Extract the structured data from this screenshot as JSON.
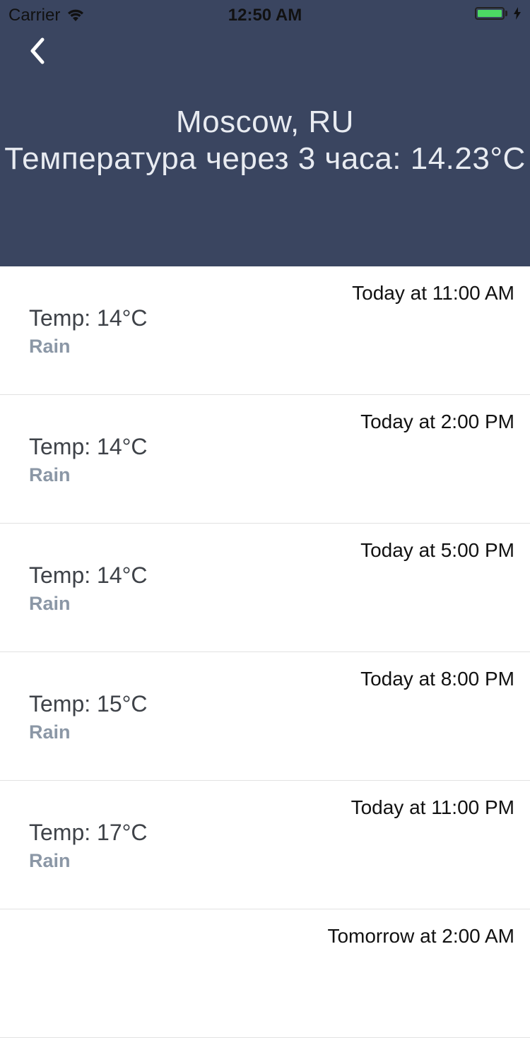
{
  "status_bar": {
    "carrier": "Carrier",
    "time": "12:50 AM",
    "battery_level": 1.0,
    "battery_color": "#4cd964"
  },
  "header": {
    "back_icon": "chevron-left-icon",
    "city": "Moscow, RU",
    "forecast": "Температура через 3 часа: 14.23°C",
    "background_color": "#3a4560"
  },
  "forecast_list": [
    {
      "time": "Today at 11:00 AM",
      "temp": "Temp: 14°C",
      "condition": "Rain"
    },
    {
      "time": "Today at 2:00 PM",
      "temp": "Temp: 14°C",
      "condition": "Rain"
    },
    {
      "time": "Today at 5:00 PM",
      "temp": "Temp: 14°C",
      "condition": "Rain"
    },
    {
      "time": "Today at 8:00 PM",
      "temp": "Temp: 15°C",
      "condition": "Rain"
    },
    {
      "time": "Today at 11:00 PM",
      "temp": "Temp: 17°C",
      "condition": "Rain"
    },
    {
      "time": "Tomorrow at 2:00 AM",
      "temp": "",
      "condition": ""
    }
  ]
}
